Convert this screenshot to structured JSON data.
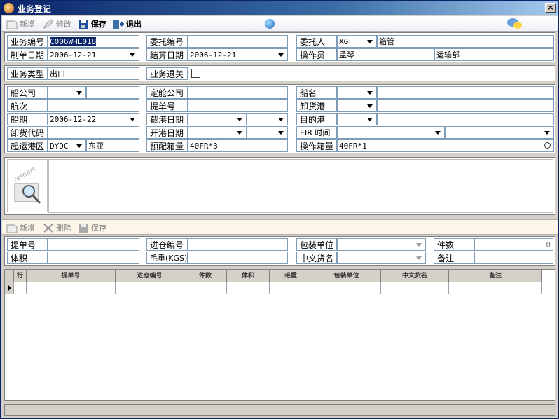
{
  "window": {
    "title": "业务登记",
    "close": "×"
  },
  "toolbar": {
    "new": "新增",
    "edit": "修改",
    "save": "保存",
    "exit": "退出"
  },
  "header": {
    "biz_no_label": "业务编号",
    "biz_no": "C006WHL018",
    "order_date_label": "制单日期",
    "order_date": "2006-12-21",
    "consign_no_label": "委托编号",
    "consign_no": "",
    "settle_date_label": "结算日期",
    "settle_date": "2006-12-21",
    "client_label": "委托人",
    "client_code": "XG",
    "client_name": "箱管",
    "operator_label": "操作员",
    "operator": "孟琴",
    "department": "运输部"
  },
  "biz": {
    "type_label": "业务类型",
    "type": "出口",
    "customs_label": "业务退关"
  },
  "ship": {
    "company_label": "船公司",
    "company": "",
    "company_extra": "",
    "voyage_label": "航次",
    "voyage": "",
    "date_label": "船期",
    "date": "2006-12-22",
    "date_extra": "",
    "unload_code_label": "卸货代码",
    "unload_code": "",
    "origin_label": "起运港区",
    "origin_code": "DYDC",
    "origin_name": "东亚",
    "booking_co_label": "定舱公司",
    "booking_co": "",
    "bl_label": "提单号",
    "bl": "",
    "cutoff_label": "截港日期",
    "cutoff": "",
    "cutoff_time": "",
    "open_label": "开港日期",
    "open": "",
    "open_time": "",
    "pre_box_label": "预配箱量",
    "pre_box": "40FR*3",
    "vessel_label": "船名",
    "vessel": "",
    "vessel_extra": "",
    "discharge_label": "卸货港",
    "discharge": "",
    "discharge_extra": "",
    "dest_label": "目的港",
    "dest": "",
    "dest_extra": "",
    "eir_label": "EIR 时间",
    "eir": "",
    "eir_time": "",
    "op_box_label": "操作箱量",
    "op_box": "40FR*1"
  },
  "remark": {
    "icon_text": "remark",
    "value": ""
  },
  "toolbar2": {
    "new": "新增",
    "delete": "删除",
    "save": "保存"
  },
  "detail": {
    "bl_label": "提单号",
    "bl": "",
    "volume_label": "体积",
    "volume": "",
    "in_no_label": "进仓编号",
    "in_no": "",
    "weight_label": "毛重(KGS)",
    "weight": "",
    "pack_label": "包装单位",
    "pack": "",
    "cn_name_label": "中文货名",
    "cn_name": "",
    "qty_label": "件数",
    "qty": "0",
    "note_label": "备注",
    "note": ""
  },
  "grid": {
    "columns": [
      "行",
      "提单号",
      "进仓编号",
      "件数",
      "体积",
      "毛重",
      "包装单位",
      "中文货名",
      "备注"
    ]
  },
  "colors": {
    "title_start": "#0a246a",
    "title_end": "#a6caf0",
    "field_border": "#7f9db9",
    "selection": "#0a246a"
  }
}
